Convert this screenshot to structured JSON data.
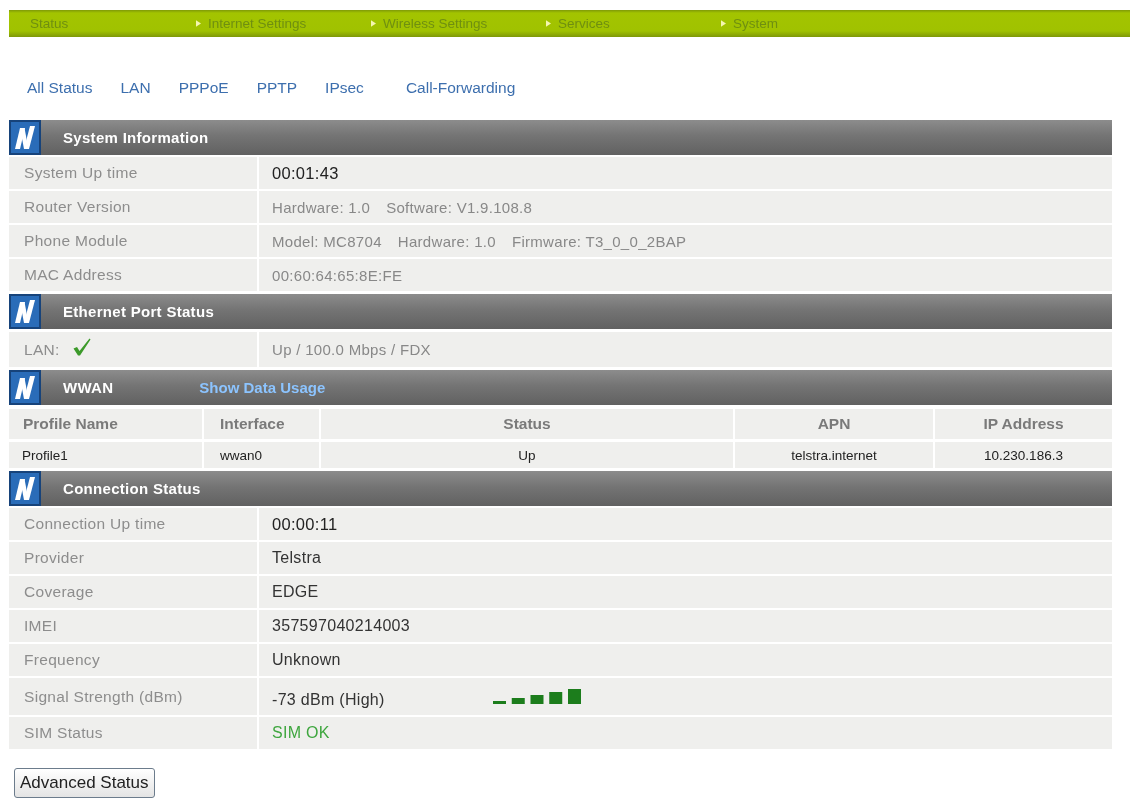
{
  "nav": [
    {
      "label": "Status",
      "arrow": false
    },
    {
      "label": "Internet Settings",
      "arrow": true
    },
    {
      "label": "Wireless Settings",
      "arrow": true
    },
    {
      "label": "Services",
      "arrow": true
    },
    {
      "label": "System",
      "arrow": true
    }
  ],
  "sub_links": [
    "All Status",
    "LAN",
    "PPPoE",
    "PPTP",
    "IPsec",
    "Call-Forwarding"
  ],
  "sections": [
    {
      "title": "System Information",
      "kind": "rows",
      "rows": [
        {
          "label": "System Up time",
          "kind": "large",
          "value": "00:01:43"
        },
        {
          "label": "Router Version",
          "kind": "muted",
          "parts": [
            "Hardware: 1.0",
            "Software: V1.9.108.8"
          ]
        },
        {
          "label": "Phone Module",
          "kind": "muted",
          "parts": [
            "Model: MC8704",
            "Hardware: 1.0",
            "Firmware: T3_0_0_2BAP"
          ]
        },
        {
          "label": "MAC Address",
          "kind": "muted",
          "value": "00:60:64:65:8E:FE"
        }
      ]
    },
    {
      "title": "Ethernet Port Status",
      "kind": "rows",
      "rows": [
        {
          "label": "LAN:",
          "kind": "check",
          "value": "Up / 100.0 Mbps / FDX"
        }
      ]
    },
    {
      "title": "WWAN",
      "link": "Show Data Usage",
      "kind": "table",
      "columns": [
        "Profile Name",
        "Interface",
        "Status",
        "APN",
        "IP Address"
      ],
      "rows": [
        [
          "Profile1",
          "wwan0",
          "Up",
          "telstra.internet",
          "10.230.186.3"
        ]
      ]
    },
    {
      "title": "Connection Status",
      "kind": "rows",
      "rows": [
        {
          "label": "Connection Up time",
          "kind": "large",
          "value": "00:00:11"
        },
        {
          "label": "Provider",
          "kind": "dark",
          "value": "Telstra"
        },
        {
          "label": "Coverage",
          "kind": "dark",
          "value": "EDGE"
        },
        {
          "label": "IMEI",
          "kind": "dark",
          "value": "357597040214003"
        },
        {
          "label": "Frequency",
          "kind": "dark",
          "value": "Unknown"
        },
        {
          "label": "Signal Strength (dBm)",
          "kind": "signal",
          "value": "-73 dBm (High)"
        },
        {
          "label": "SIM Status",
          "kind": "ok",
          "value": "SIM OK"
        }
      ]
    }
  ],
  "button": "Advanced Status"
}
